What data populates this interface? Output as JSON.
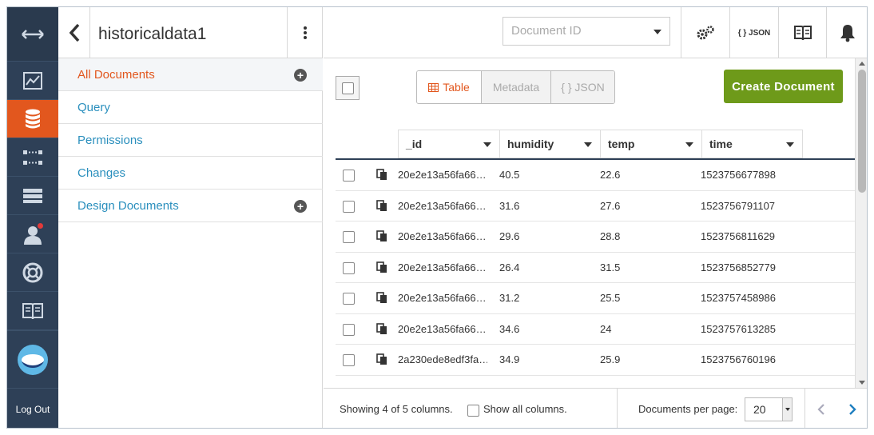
{
  "nav": {
    "items": [
      {
        "icon": "expand-arrows-icon"
      },
      {
        "icon": "activity-chart-icon"
      },
      {
        "icon": "database-icon",
        "active": true
      },
      {
        "icon": "replication-icon"
      },
      {
        "icon": "server-config-icon"
      },
      {
        "icon": "user-icon"
      },
      {
        "icon": "support-lifebuoy-icon"
      },
      {
        "icon": "documentation-book-icon"
      }
    ],
    "logo": "cloudant-logo",
    "logout_label": "Log Out",
    "accent_color": "#e2571e"
  },
  "sidebar": {
    "database_name": "historicaldata1",
    "items": [
      {
        "label": "All Documents"
      },
      {
        "label": "Query"
      },
      {
        "label": "Permissions"
      },
      {
        "label": "Changes"
      },
      {
        "label": "Design Documents"
      }
    ]
  },
  "header": {
    "doc_id_placeholder": "Document ID",
    "json_label": "{ } JSON"
  },
  "toolbar": {
    "view_table": "Table",
    "view_metadata": "Metadata",
    "view_json": "{ } JSON",
    "create_label": "Create Document",
    "create_color": "#6e9a1a"
  },
  "table": {
    "columns": [
      "_id",
      "humidity",
      "temp",
      "time"
    ],
    "rows": [
      [
        "20e2e13a56fa66…",
        "40.5",
        "22.6",
        "1523756677898"
      ],
      [
        "20e2e13a56fa66…",
        "31.6",
        "27.6",
        "1523756791107"
      ],
      [
        "20e2e13a56fa66…",
        "29.6",
        "28.8",
        "1523756811629"
      ],
      [
        "20e2e13a56fa66…",
        "26.4",
        "31.5",
        "1523756852779"
      ],
      [
        "20e2e13a56fa66…",
        "31.2",
        "25.5",
        "1523757458986"
      ],
      [
        "20e2e13a56fa66…",
        "34.6",
        "24",
        "1523757613285"
      ],
      [
        "2a230ede8edf3fa…",
        "34.9",
        "25.9",
        "1523756760196"
      ]
    ]
  },
  "footer": {
    "showing_text": "Showing 4 of 5 columns.",
    "show_all_label": "Show all columns.",
    "per_page_label": "Documents per page:",
    "per_page_value": "20"
  }
}
